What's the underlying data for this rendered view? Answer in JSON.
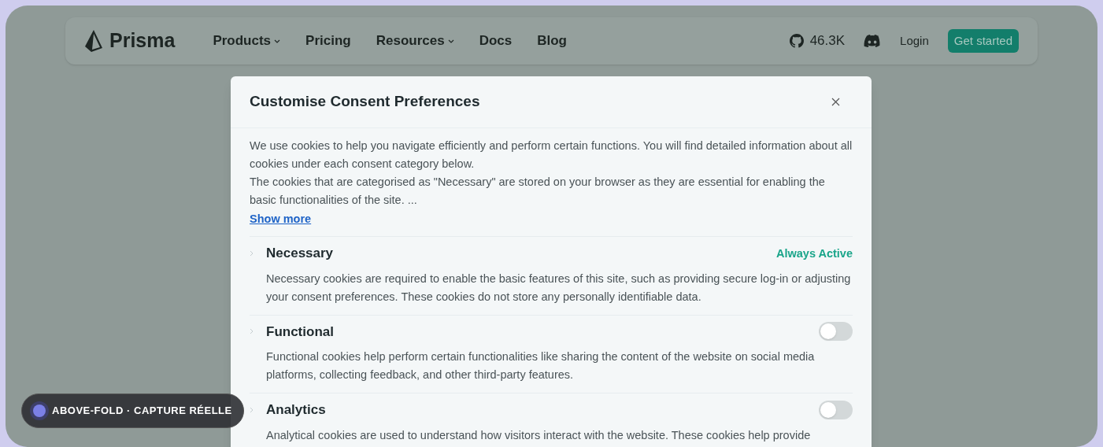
{
  "nav": {
    "brand": "Prisma",
    "links": [
      {
        "label": "Products",
        "dropdown": true
      },
      {
        "label": "Pricing",
        "dropdown": false
      },
      {
        "label": "Resources",
        "dropdown": true
      },
      {
        "label": "Docs",
        "dropdown": false
      },
      {
        "label": "Blog",
        "dropdown": false
      }
    ],
    "github_stars": "46.3K",
    "login": "Login",
    "cta": "Get started"
  },
  "modal": {
    "title": "Customise Consent Preferences",
    "intro": [
      "We use cookies to help you navigate efficiently and perform certain functions. You will find detailed information about all cookies under each consent category below.",
      "The cookies that are categorised as \"Necessary\" are stored on your browser as they are essential for enabling the basic functionalities of the site. ..."
    ],
    "show_more": "Show more",
    "categories": [
      {
        "kind": "always_active",
        "name": "Necessary",
        "status": "Always Active",
        "description": "Necessary cookies are required to enable the basic features of this site, such as providing secure log-in or adjusting your consent preferences. These cookies do not store any personally identifiable data."
      },
      {
        "kind": "toggle",
        "name": "Functional",
        "on": false,
        "description": "Functional cookies help perform certain functionalities like sharing the content of the website on social media platforms, collecting feedback, and other third-party features."
      },
      {
        "kind": "toggle",
        "name": "Analytics",
        "on": false,
        "description": "Analytical cookies are used to understand how visitors interact with the website. These cookies help provide"
      }
    ]
  },
  "badge": {
    "label": "ABOVE-FOLD · CAPTURE RÉELLE"
  }
}
